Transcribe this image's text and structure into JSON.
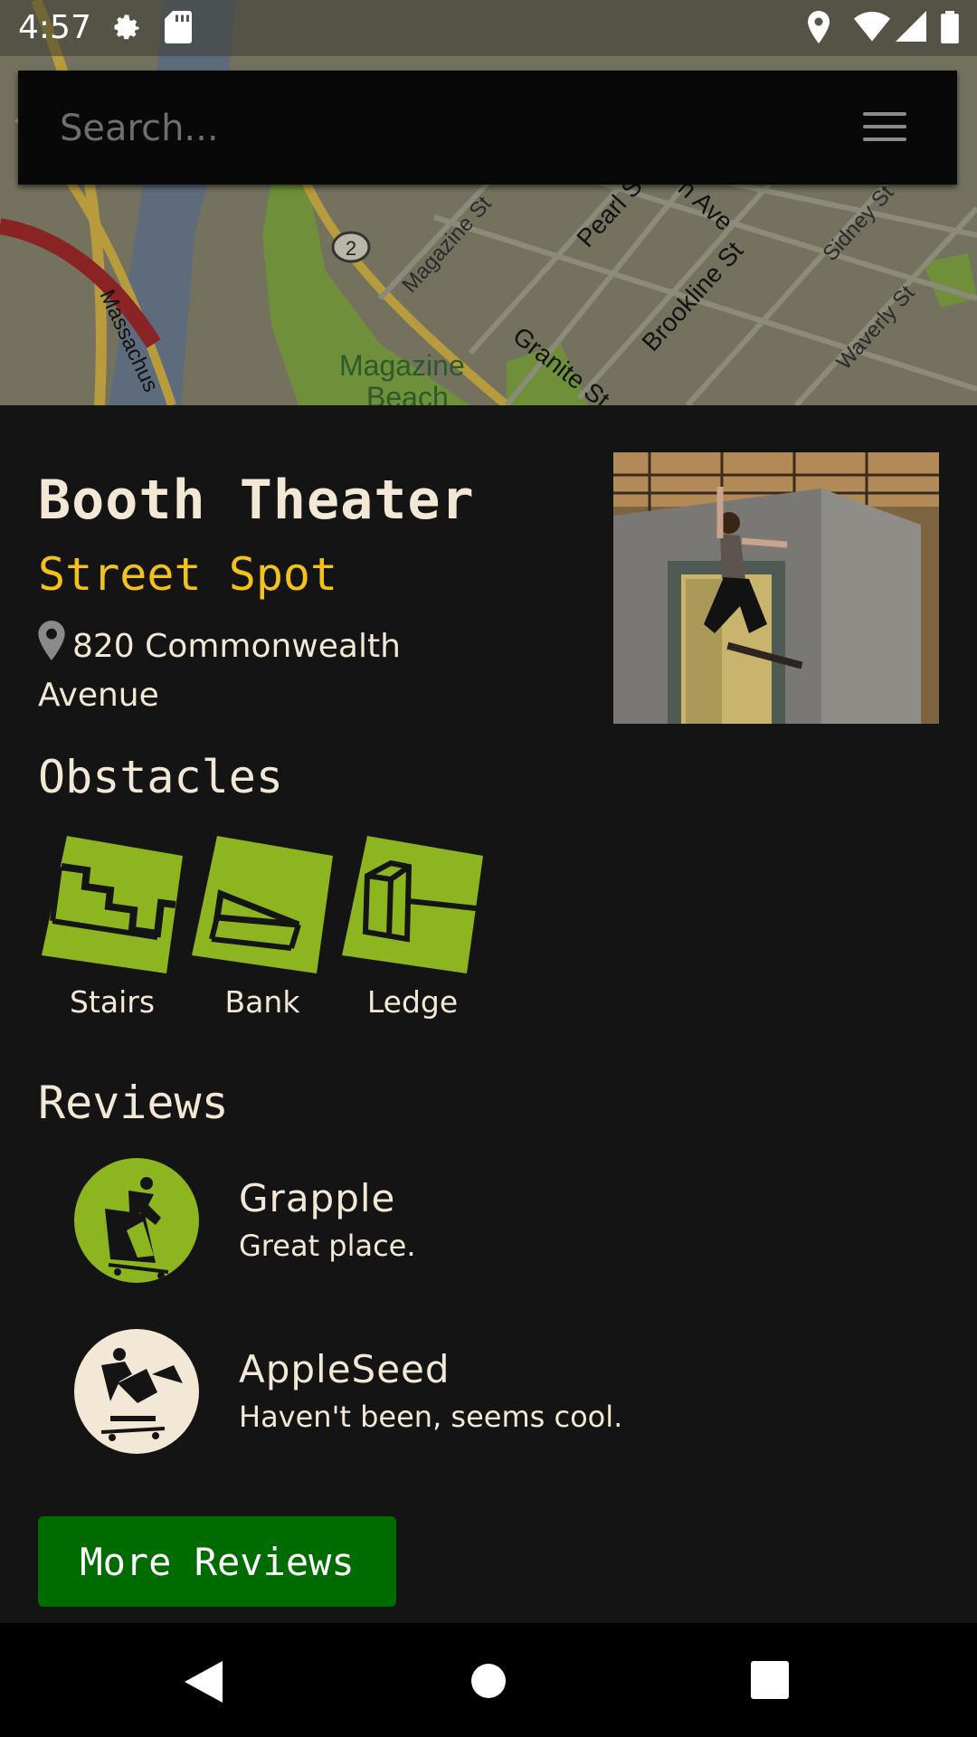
{
  "status_bar": {
    "time": "4:57",
    "left_icons": [
      "gear-icon",
      "sd-card-icon"
    ],
    "right_icons": [
      "location-icon",
      "wifi-icon",
      "signal-icon",
      "battery-icon"
    ]
  },
  "search": {
    "placeholder": "Search...",
    "menu_icon": "hamburger-menu-icon"
  },
  "map": {
    "labels": [
      "Magazine St",
      "Pearl St",
      "n Ave",
      "Brookline St",
      "Sidney St",
      "Granite St",
      "Waverly St",
      "Massachus",
      "Magazine",
      "Beach",
      "2"
    ]
  },
  "spot": {
    "name": "Booth Theater",
    "type": "Street Spot",
    "address": "820 Commonwealth Avenue"
  },
  "obstacles": {
    "heading": "Obstacles",
    "items": [
      {
        "label": "Stairs",
        "icon": "stairs-icon"
      },
      {
        "label": "Bank",
        "icon": "bank-icon"
      },
      {
        "label": "Ledge",
        "icon": "ledge-icon"
      }
    ]
  },
  "reviews": {
    "heading": "Reviews",
    "items": [
      {
        "name": "Grapple",
        "text": "Great place.",
        "avatar_color": "#8db51f"
      },
      {
        "name": "AppleSeed",
        "text": "Haven't been, seems cool.",
        "avatar_color": "#f2e8d5"
      }
    ],
    "more_label": "More Reviews"
  },
  "colors": {
    "background": "#141414",
    "title": "#f2e8d5",
    "accent_yellow": "#f2c21a",
    "obstacle_green": "#8db51f",
    "button_green": "#006b00"
  },
  "nav": {
    "icons": [
      "back-triangle-icon",
      "home-circle-icon",
      "recents-square-icon"
    ]
  }
}
